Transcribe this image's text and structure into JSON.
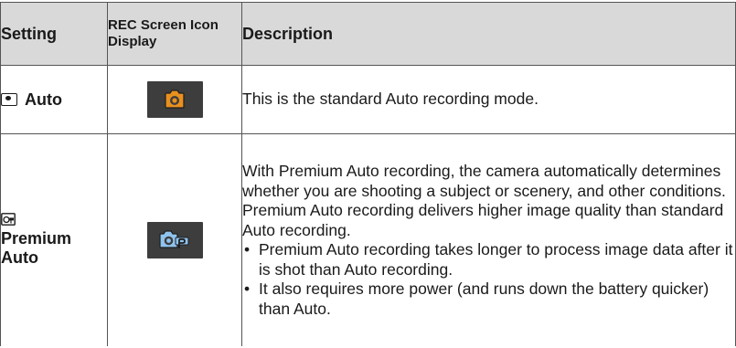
{
  "table": {
    "headers": {
      "setting": "Setting",
      "icon_display": "REC Screen Icon Display",
      "description": "Description"
    },
    "rows": [
      {
        "setting_label": "Auto",
        "setting_icon": "auto-camera-mode-icon",
        "badge_icon": "orange-camera-icon",
        "description": "This is the standard Auto recording mode."
      },
      {
        "setting_label": "Premium Auto",
        "setting_icon": "premium-auto-mode-icon",
        "badge_icon": "premium-auto-camera-icon",
        "description": "With Premium Auto recording, the camera automatically determines whether you are shooting a subject or scenery, and other conditions. Premium Auto recording delivers higher image quality than standard Auto recording.",
        "bullets": [
          "Premium Auto recording takes longer to process image data after it is shot than Auto recording.",
          "It also requires more power (and runs down the battery quicker) than Auto."
        ]
      }
    ]
  },
  "colors": {
    "header_bg": "#d9d9d9",
    "border": "#555555",
    "badge_bg": "#3d3d3d",
    "auto_icon": "#e8901f",
    "premium_icon": "#8fc3ee"
  }
}
